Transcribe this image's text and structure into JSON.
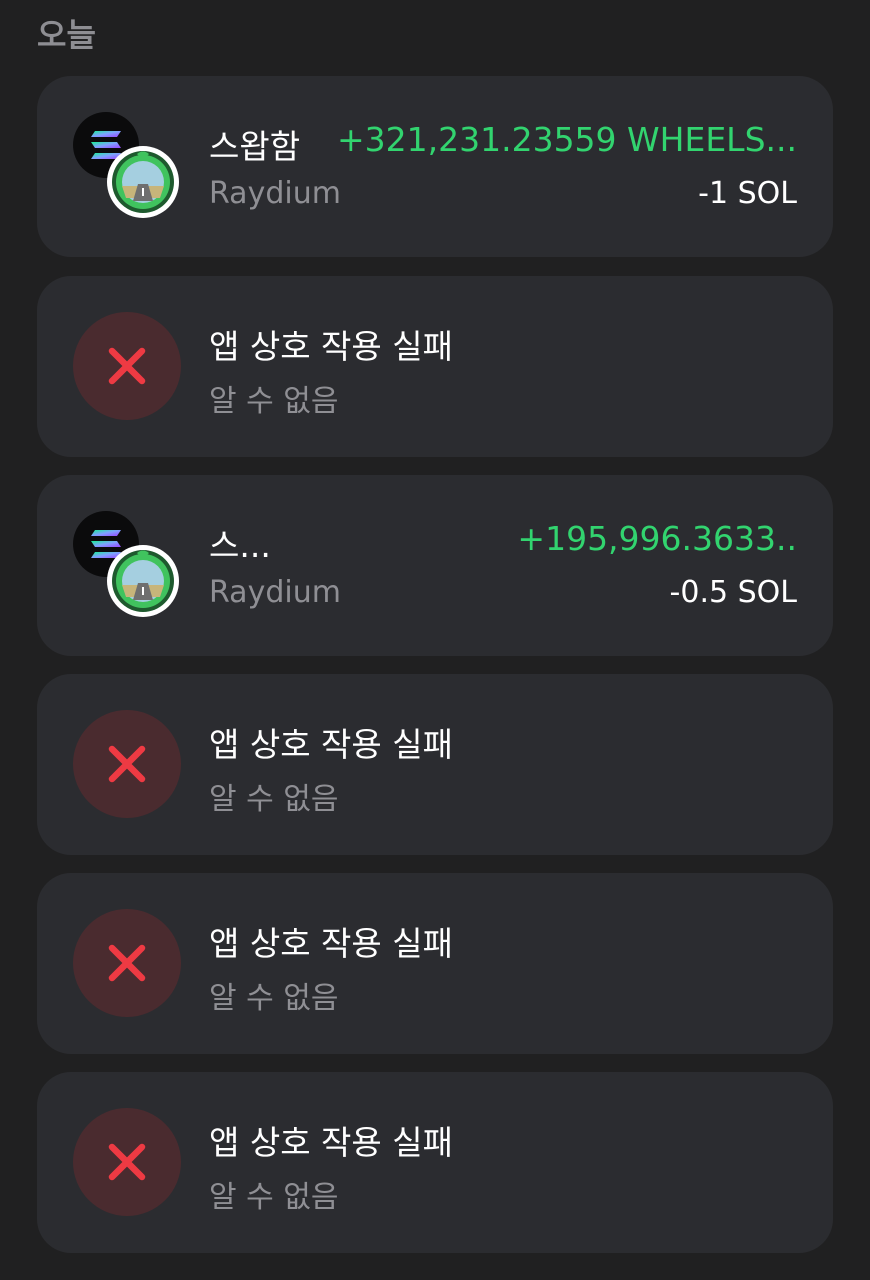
{
  "section": {
    "title": "오늘"
  },
  "colors": {
    "background": "#202021",
    "card": "#2b2c30",
    "positive": "#32d46f",
    "fail_red": "#ee3a43",
    "fail_bg": "#4a2b2f"
  },
  "transactions": [
    {
      "type": "swap",
      "title": "스왑함",
      "subtitle": "Raydium",
      "amount_in": "+321,231.23559 WHEELS...",
      "amount_out": "-1 SOL",
      "icons": [
        "solana-icon",
        "wheels-token-icon"
      ]
    },
    {
      "type": "failed",
      "title": "앱 상호 작용 실패",
      "subtitle": "알 수 없음",
      "icon": "x-icon"
    },
    {
      "type": "swap",
      "title": "스...",
      "subtitle": "Raydium",
      "amount_in": "+195,996.3633..",
      "amount_out": "-0.5 SOL",
      "icons": [
        "solana-icon",
        "wheels-token-icon"
      ]
    },
    {
      "type": "failed",
      "title": "앱 상호 작용 실패",
      "subtitle": "알 수 없음",
      "icon": "x-icon"
    },
    {
      "type": "failed",
      "title": "앱 상호 작용 실패",
      "subtitle": "알 수 없음",
      "icon": "x-icon"
    },
    {
      "type": "failed",
      "title": "앱 상호 작용 실패",
      "subtitle": "알 수 없음",
      "icon": "x-icon"
    }
  ]
}
